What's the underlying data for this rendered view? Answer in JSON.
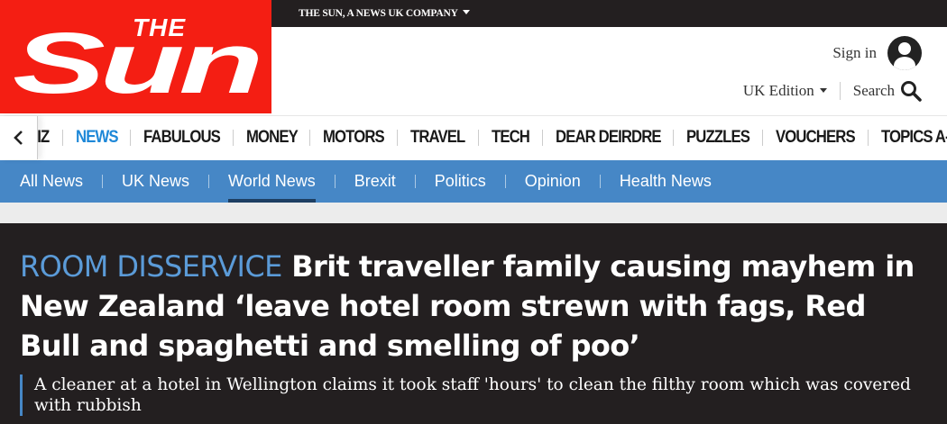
{
  "brand": {
    "logo_top": "THE",
    "logo_main": "Sun",
    "company": "THE SUN, A NEWS UK COMPANY",
    "logo_color": "#f41e13"
  },
  "header": {
    "signin": "Sign in",
    "edition": "UK Edition",
    "search": "Search",
    "avatar_icon": "user-avatar-icon",
    "search_icon": "magnifier-icon"
  },
  "main_nav": {
    "back_icon": "chevron-left-icon",
    "items": [
      {
        "label": "BIZ",
        "active": false
      },
      {
        "label": "NEWS",
        "active": true
      },
      {
        "label": "FABULOUS",
        "active": false
      },
      {
        "label": "MONEY",
        "active": false
      },
      {
        "label": "MOTORS",
        "active": false
      },
      {
        "label": "TRAVEL",
        "active": false
      },
      {
        "label": "TECH",
        "active": false
      },
      {
        "label": "DEAR DEIRDRE",
        "active": false
      },
      {
        "label": "PUZZLES",
        "active": false
      },
      {
        "label": "VOUCHERS",
        "active": false
      },
      {
        "label": "TOPICS A-Z",
        "active": false
      }
    ]
  },
  "sub_nav": {
    "items": [
      {
        "label": "All News",
        "active": false
      },
      {
        "label": "UK News",
        "active": false
      },
      {
        "label": "World News",
        "active": true
      },
      {
        "label": "Brexit",
        "active": false
      },
      {
        "label": "Politics",
        "active": false
      },
      {
        "label": "Opinion",
        "active": false
      },
      {
        "label": "Health News",
        "active": false
      }
    ],
    "bar_color": "#4687c6"
  },
  "article": {
    "kicker": "ROOM DISSERVICE",
    "headline": "Brit traveller family causing mayhem in New Zealand ‘leave hotel room strewn with fags, Red Bull and spaghetti and smelling of poo’",
    "standfirst": "A cleaner at a hotel in Wellington claims it took staff 'hours' to clean the filthy room which was covered with rubbish",
    "kicker_color": "#5b9bd8",
    "background": "#231f20"
  }
}
